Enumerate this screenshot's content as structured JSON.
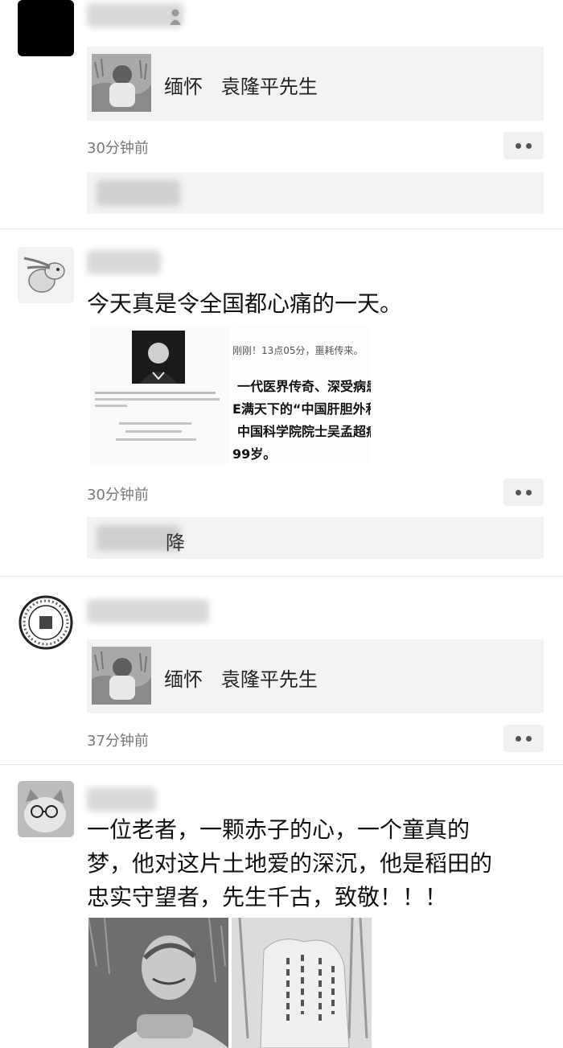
{
  "posts": [
    {
      "link_title": "缅怀   袁隆平先生",
      "time": "30分钟前"
    },
    {
      "text": "今天真是令全国都心痛的一天。",
      "article_line1": "刚刚！13点05分，噩耗传来。",
      "article_line2": "一代医界传奇、深受病患爱",
      "article_line3": "E满天下的“中国肝胆外和",
      "article_line4": "中国科学院院士吴孟超病",
      "article_line5": "99岁。",
      "comment_partial": "降",
      "time": "30分钟前"
    },
    {
      "link_title": "缅怀   袁隆平先生",
      "time": "37分钟前"
    },
    {
      "text_line1": "一位老者，一颗赤子的心，一个童真的",
      "text_line2": "梦，他对这片土地爱的深沉，他是稻田的",
      "text_line3": "忠实守望者，先生千古，致敬！！！"
    }
  ],
  "icons": {
    "more": "more-dots-icon",
    "person": "person-icon"
  },
  "colors": {
    "background": "#ffffff",
    "card": "#f3f3f3",
    "time_text": "#777777"
  }
}
